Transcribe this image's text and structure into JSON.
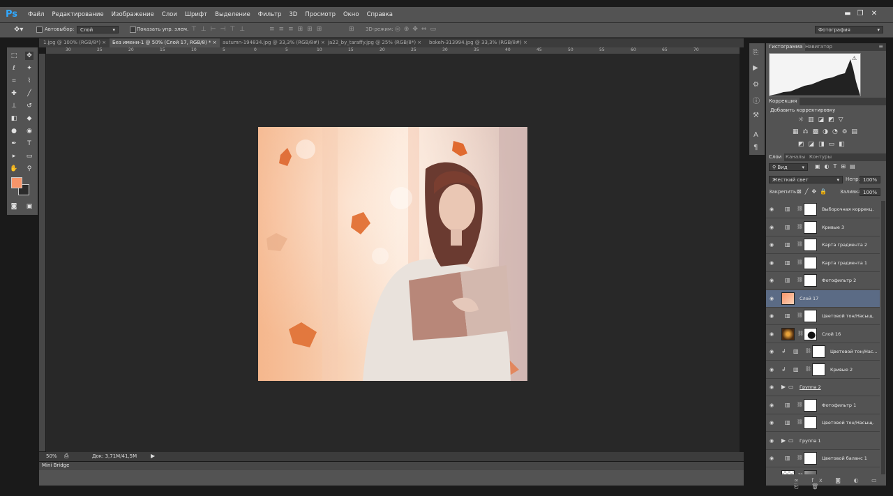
{
  "app": {
    "logo": "Ps"
  },
  "menu": [
    "Файл",
    "Редактирование",
    "Изображение",
    "Слои",
    "Шрифт",
    "Выделение",
    "Фильтр",
    "3D",
    "Просмотр",
    "Окно",
    "Справка"
  ],
  "window_controls": {
    "minimize": "▬",
    "restore": "❐",
    "close": "✕"
  },
  "options": {
    "autoselect_label": "Автовыбор:",
    "autoselect_value": "Слой",
    "show_transform_label": "Показать упр. элем.",
    "mode3d_label": "3D-режим:",
    "workspace_value": "Фотография"
  },
  "doc_tabs": [
    {
      "label": "1.jpg @ 100% (RGB/8*)"
    },
    {
      "label": "Без имени-1 @ 50% (Слой 17, RGB/8) *"
    },
    {
      "label": "autumn-194834.jpg @ 33,3% (RGB/8#)"
    },
    {
      "label": "ja22_by_taraffy.jpg @ 25% (RGB/8*)"
    },
    {
      "label": "bokeh-313994.jpg @ 33,3% (RGB/8#)"
    }
  ],
  "ruler_labels": [
    "30",
    "25",
    "20",
    "15",
    "10",
    "5",
    "0",
    "5",
    "10",
    "15",
    "20",
    "25",
    "30",
    "35",
    "40",
    "45",
    "50",
    "55",
    "60",
    "65",
    "70"
  ],
  "status": {
    "zoom": "50%",
    "doc": "Док: 3,71M/41,5M"
  },
  "mini_bridge": "Mini Bridge",
  "panels": {
    "histogram_tab": "Гистограмма",
    "navigator_tab": "Навигатор",
    "corrections_tab": "Коррекция",
    "add_adjustment": "Добавить корректировку",
    "layers_tab": "Слои",
    "channels_tab": "Каналы",
    "paths_tab": "Контуры",
    "kind_filter": "Вид",
    "blend_mode": "Жесткий свет",
    "opacity_label": "Непр:",
    "opacity_value": "100%",
    "lock_label": "Закрепить:",
    "fill_label": "Заливка:",
    "fill_value": "100%"
  },
  "layers": [
    {
      "name": "Выборочная коррекц...",
      "type": "adjustment"
    },
    {
      "name": "Кривые 3",
      "type": "adjustment"
    },
    {
      "name": "Карта градиента 2",
      "type": "adjustment"
    },
    {
      "name": "Карта градиента 1",
      "type": "adjustment"
    },
    {
      "name": "Фотофильтр 2",
      "type": "adjustment"
    },
    {
      "name": "Слой 17",
      "type": "pixel",
      "selected": true
    },
    {
      "name": "Цветовой тон/Насыщ...",
      "type": "adjustment"
    },
    {
      "name": "Слой 16",
      "type": "pixel-mask"
    },
    {
      "name": "Цветовой тон/Нас...",
      "type": "adjustment-clipped"
    },
    {
      "name": "Кривые 2",
      "type": "adjustment-clipped"
    },
    {
      "name": "Группа 2",
      "type": "group"
    },
    {
      "name": "Фотофильтр 1",
      "type": "adjustment"
    },
    {
      "name": "Цветовой тон/Насыщ...",
      "type": "adjustment"
    },
    {
      "name": "Группа 1",
      "type": "group"
    },
    {
      "name": "Цветовой баланс 1",
      "type": "adjustment"
    },
    {
      "name": "Слой 3",
      "type": "pixel-transparent"
    }
  ],
  "colors": {
    "foreground": "#f7956a",
    "background": "#2b2b2b",
    "selected_layer": "#5b6b85"
  }
}
